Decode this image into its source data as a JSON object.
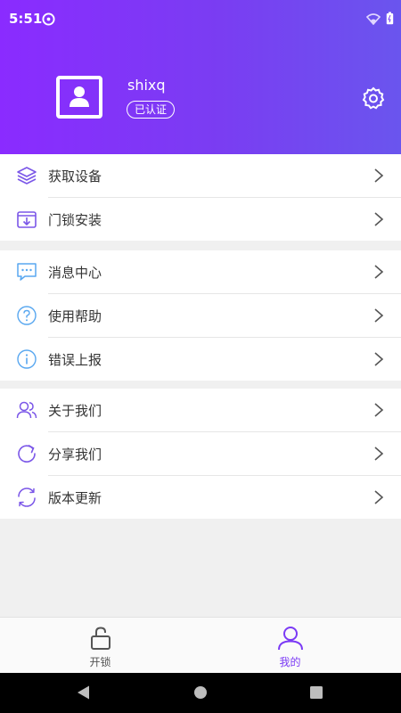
{
  "status_bar": {
    "time": "5:51"
  },
  "profile": {
    "username": "shixq",
    "badge": "已认证"
  },
  "menu_groups": [
    {
      "items": [
        {
          "label": "获取设备",
          "icon": "layers-icon"
        },
        {
          "label": "门锁安装",
          "icon": "download-box-icon"
        }
      ]
    },
    {
      "items": [
        {
          "label": "消息中心",
          "icon": "chat-bubble-icon"
        },
        {
          "label": "使用帮助",
          "icon": "help-circle-icon"
        },
        {
          "label": "错误上报",
          "icon": "info-circle-icon"
        }
      ]
    },
    {
      "items": [
        {
          "label": "关于我们",
          "icon": "users-icon"
        },
        {
          "label": "分享我们",
          "icon": "share-refresh-icon"
        },
        {
          "label": "版本更新",
          "icon": "sync-icon"
        }
      ]
    }
  ],
  "tabs": [
    {
      "label": "开锁",
      "icon": "lock-icon",
      "active": false
    },
    {
      "label": "我的",
      "icon": "user-icon",
      "active": true
    }
  ],
  "colors": {
    "accent": "#7b3af5",
    "icon_purple": "#7b57e8",
    "icon_blue": "#58a7f0",
    "chevron": "#555555",
    "tab_inactive": "#555555"
  }
}
